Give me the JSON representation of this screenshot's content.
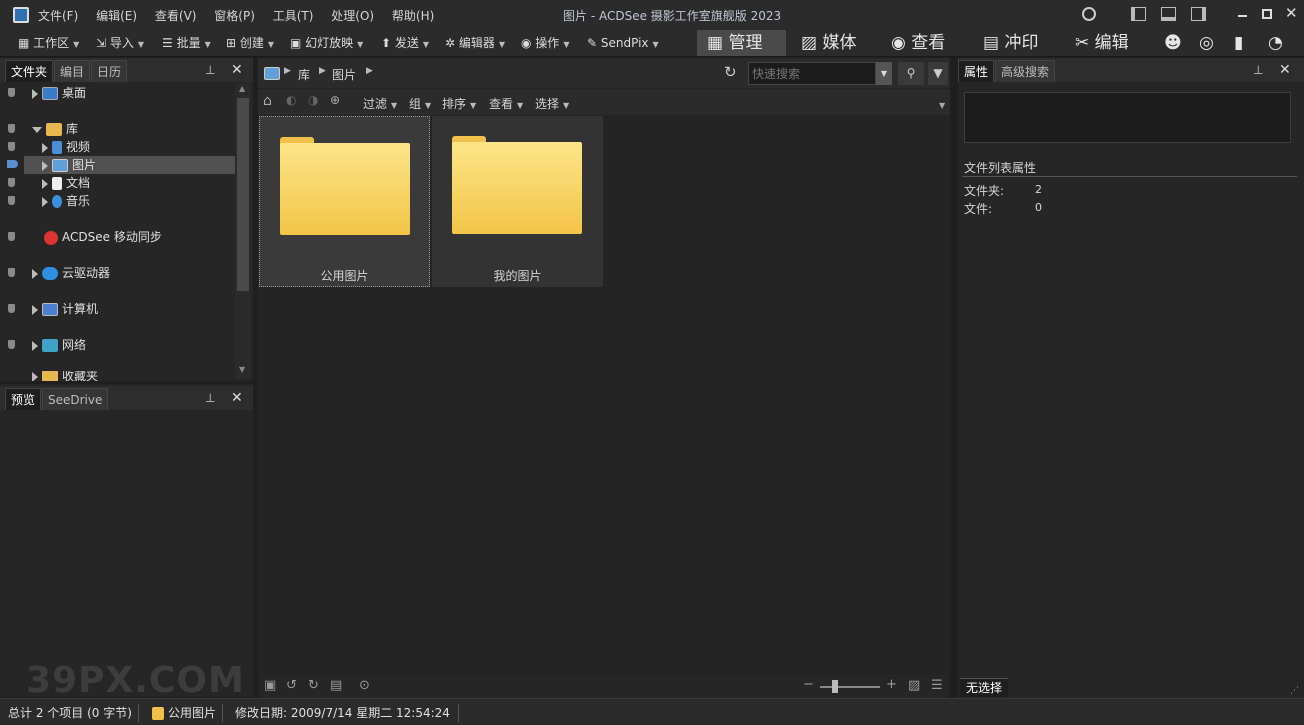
{
  "window": {
    "title": "图片 - ACDSee 摄影工作室旗舰版 2023"
  },
  "menu": [
    "文件(F)",
    "编辑(E)",
    "查看(V)",
    "窗格(P)",
    "工具(T)",
    "处理(O)",
    "帮助(H)"
  ],
  "toolbar": {
    "workspace": "工作区",
    "import": "导入",
    "batch": "批量",
    "create": "创建",
    "slideshow": "幻灯放映",
    "send": "发送",
    "editor": "编辑器",
    "action": "操作",
    "sendpix": "SendPix"
  },
  "modes": {
    "manage": "管理",
    "media": "媒体",
    "view": "查看",
    "develop": "冲印",
    "edit": "编辑"
  },
  "left_tabs": [
    "文件夹",
    "编目",
    "日历"
  ],
  "tree": {
    "desktop": "桌面",
    "library": "库",
    "videos": "视频",
    "pictures": "图片",
    "documents": "文档",
    "music": "音乐",
    "mobile_sync": "ACDSee 移动同步",
    "cloud": "云驱动器",
    "computer": "计算机",
    "network": "网络",
    "favorites": "收藏夹"
  },
  "preview_tabs": [
    "预览",
    "SeeDrive"
  ],
  "breadcrumb": [
    "库",
    "图片"
  ],
  "search": {
    "placeholder": "快速搜索"
  },
  "browser_bar": {
    "filter": "过滤",
    "group": "组",
    "sort": "排序",
    "view": "查看",
    "select": "选择"
  },
  "folders": [
    {
      "name": "公用图片"
    },
    {
      "name": "我的图片"
    }
  ],
  "right_tabs": [
    "属性",
    "高级搜索"
  ],
  "properties": {
    "section": "文件列表属性",
    "folders_label": "文件夹:",
    "folders_value": "2",
    "files_label": "文件:",
    "files_value": "0",
    "no_selection": "无选择"
  },
  "status": {
    "total": "总计 2 个项目  (0 字节)",
    "current": "公用图片",
    "modified": "修改日期: 2009/7/14 星期二 12:54:24"
  },
  "watermark": "39PX.COM",
  "colors": {
    "folder": "#f5cb55",
    "panel": "#262626",
    "active_mode": "#4a4a4a"
  }
}
